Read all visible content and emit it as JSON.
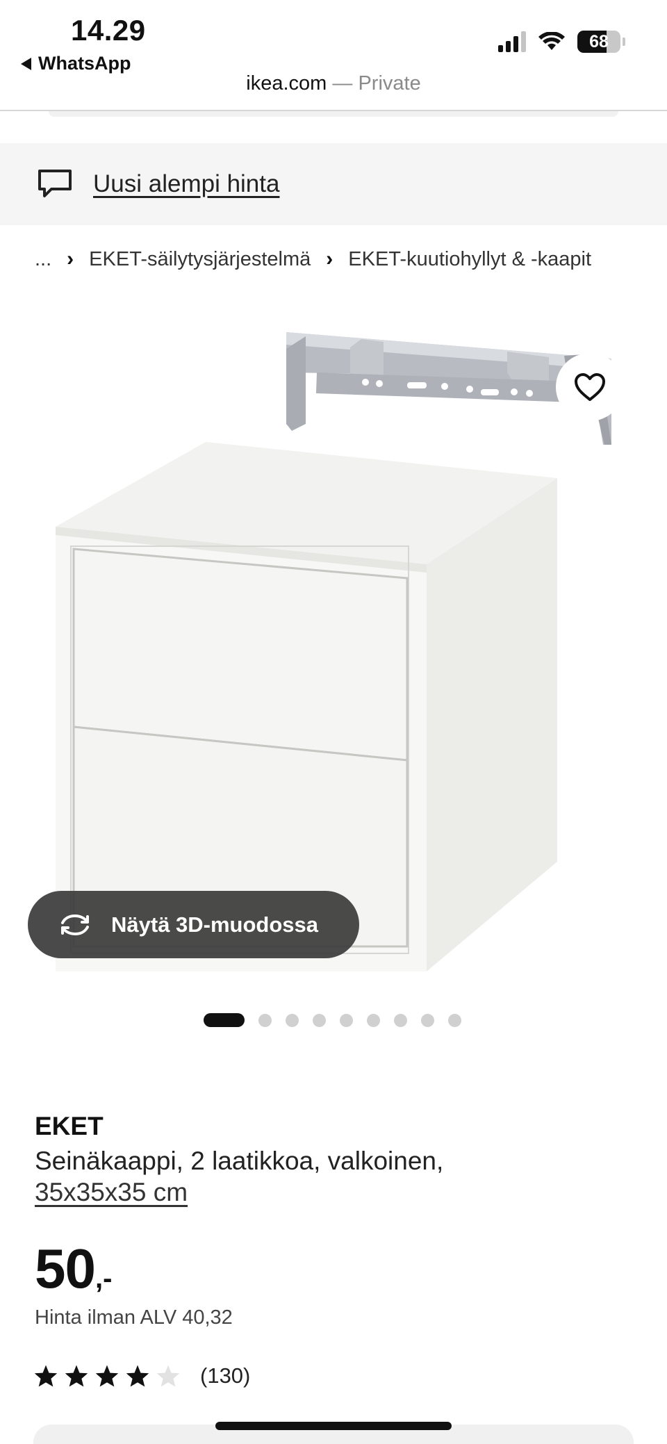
{
  "status_bar": {
    "time": "14.29",
    "back_app": "WhatsApp",
    "battery": "68",
    "url_domain": "ikea.com",
    "url_suffix": " — Private"
  },
  "banner": {
    "icon": "chat-bubble-icon",
    "text": "Uusi alempi hinta"
  },
  "breadcrumb": {
    "ellipsis": "...",
    "items": [
      "EKET-säilytysjärjestelmä",
      "EKET-kuutiohyllyt & -kaapit"
    ]
  },
  "gallery": {
    "favorite_icon": "heart-icon",
    "view3d_icon": "rotate-icon",
    "view3d_label": "Näytä 3D-muodossa",
    "dot_count": 9,
    "active_dot": 0
  },
  "product": {
    "brand": "EKET",
    "description": "Seinäkaappi, 2 laatikkoa, valkoinen,",
    "size": "35x35x35 cm",
    "price_int": "50",
    "price_dec": ",-",
    "vat_text": "Hinta ilman ALV 40,32",
    "rating_stars": 4,
    "rating_max": 5,
    "review_count": "(130)"
  },
  "colors": {
    "banner_bg": "#f5f5f5",
    "pill_bg": "#3c3c3c",
    "star": "#111111",
    "star_empty": "#e2e2e2"
  }
}
